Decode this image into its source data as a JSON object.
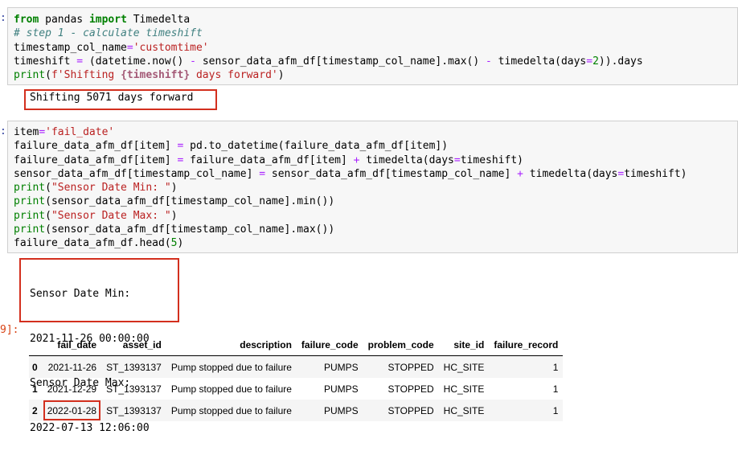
{
  "cell1": {
    "prompt": ":",
    "code_lines": {
      "l1_kw1": "from",
      "l1_mod": " pandas ",
      "l1_kw2": "import",
      "l1_name": " Timedelta",
      "l2_comment": "# step 1 - calculate timeshift",
      "l3_var": "timestamp_col_name",
      "l3_eq": "=",
      "l3_str": "'customtime'",
      "l4_a": "timeshift ",
      "l4_eq": "=",
      "l4_b": " (datetime.now() ",
      "l4_m1": "-",
      "l4_c": " sensor_data_afm_df[timestamp_col_name].max() ",
      "l4_m2": "-",
      "l4_d": " timedelta(days",
      "l4_eq2": "=",
      "l4_num": "2",
      "l4_e": ")).days",
      "l5_print": "print",
      "l5_a": "(",
      "l5_str1": "f'Shifting ",
      "l5_var": "{timeshift}",
      "l5_str2": " days forward'",
      "l5_b": ")"
    },
    "output": "Shifting 5071 days forward"
  },
  "cell2": {
    "prompt": ":",
    "code_lines": {
      "l1_var": "item",
      "l1_eq": "=",
      "l1_str": "'fail_date'",
      "l2_a": "failure_data_afm_df[item] ",
      "l2_eq": "=",
      "l2_b": " pd.to_datetime(failure_data_afm_df[item])",
      "l3_a": "failure_data_afm_df[item] ",
      "l3_eq": "=",
      "l3_b": " failure_data_afm_df[item] ",
      "l3_plus": "+",
      "l3_c": " timedelta(days",
      "l3_eq2": "=",
      "l3_d": "timeshift)",
      "l4_a": "sensor_data_afm_df[timestamp_col_name] ",
      "l4_eq": "=",
      "l4_b": " sensor_data_afm_df[timestamp_col_name] ",
      "l4_plus": "+",
      "l4_c": " timedelta(days",
      "l4_eq2": "=",
      "l4_d": "timeshift)",
      "l5_print": "print",
      "l5_a": "(",
      "l5_str": "\"Sensor Date Min: \"",
      "l5_b": ")",
      "l6_print": "print",
      "l6_a": "(sensor_data_afm_df[timestamp_col_name].min())",
      "l7_print": "print",
      "l7_a": "(",
      "l7_str": "\"Sensor Date Max: \"",
      "l7_b": ")",
      "l8_print": "print",
      "l8_a": "(sensor_data_afm_df[timestamp_col_name].max())",
      "l9_a": "failure_data_afm_df.head(",
      "l9_num": "5",
      "l9_b": ")"
    },
    "output": [
      "Sensor Date Min:",
      "2021-11-26 00:00:00",
      "Sensor Date Max:",
      "2022-07-13 12:06:00"
    ]
  },
  "out_prompt": "9]:",
  "table": {
    "columns": [
      "fail_date",
      "asset_id",
      "description",
      "failure_code",
      "problem_code",
      "site_id",
      "failure_record"
    ],
    "rows": [
      {
        "index": "0",
        "cells": [
          "2021-11-26",
          "ST_1393137",
          "Pump stopped due to failure",
          "PUMPS",
          "STOPPED",
          "HC_SITE",
          "1"
        ]
      },
      {
        "index": "1",
        "cells": [
          "2021-12-29",
          "ST_1393137",
          "Pump stopped due to failure",
          "PUMPS",
          "STOPPED",
          "HC_SITE",
          "1"
        ]
      },
      {
        "index": "2",
        "cells": [
          "2022-01-28",
          "ST_1393137",
          "Pump stopped due to failure",
          "PUMPS",
          "STOPPED",
          "HC_SITE",
          "1"
        ]
      }
    ]
  },
  "colors": {
    "highlight_border": "#d32f1e",
    "cell_bg": "#f7f7f7",
    "out_prompt": "#d84315"
  }
}
